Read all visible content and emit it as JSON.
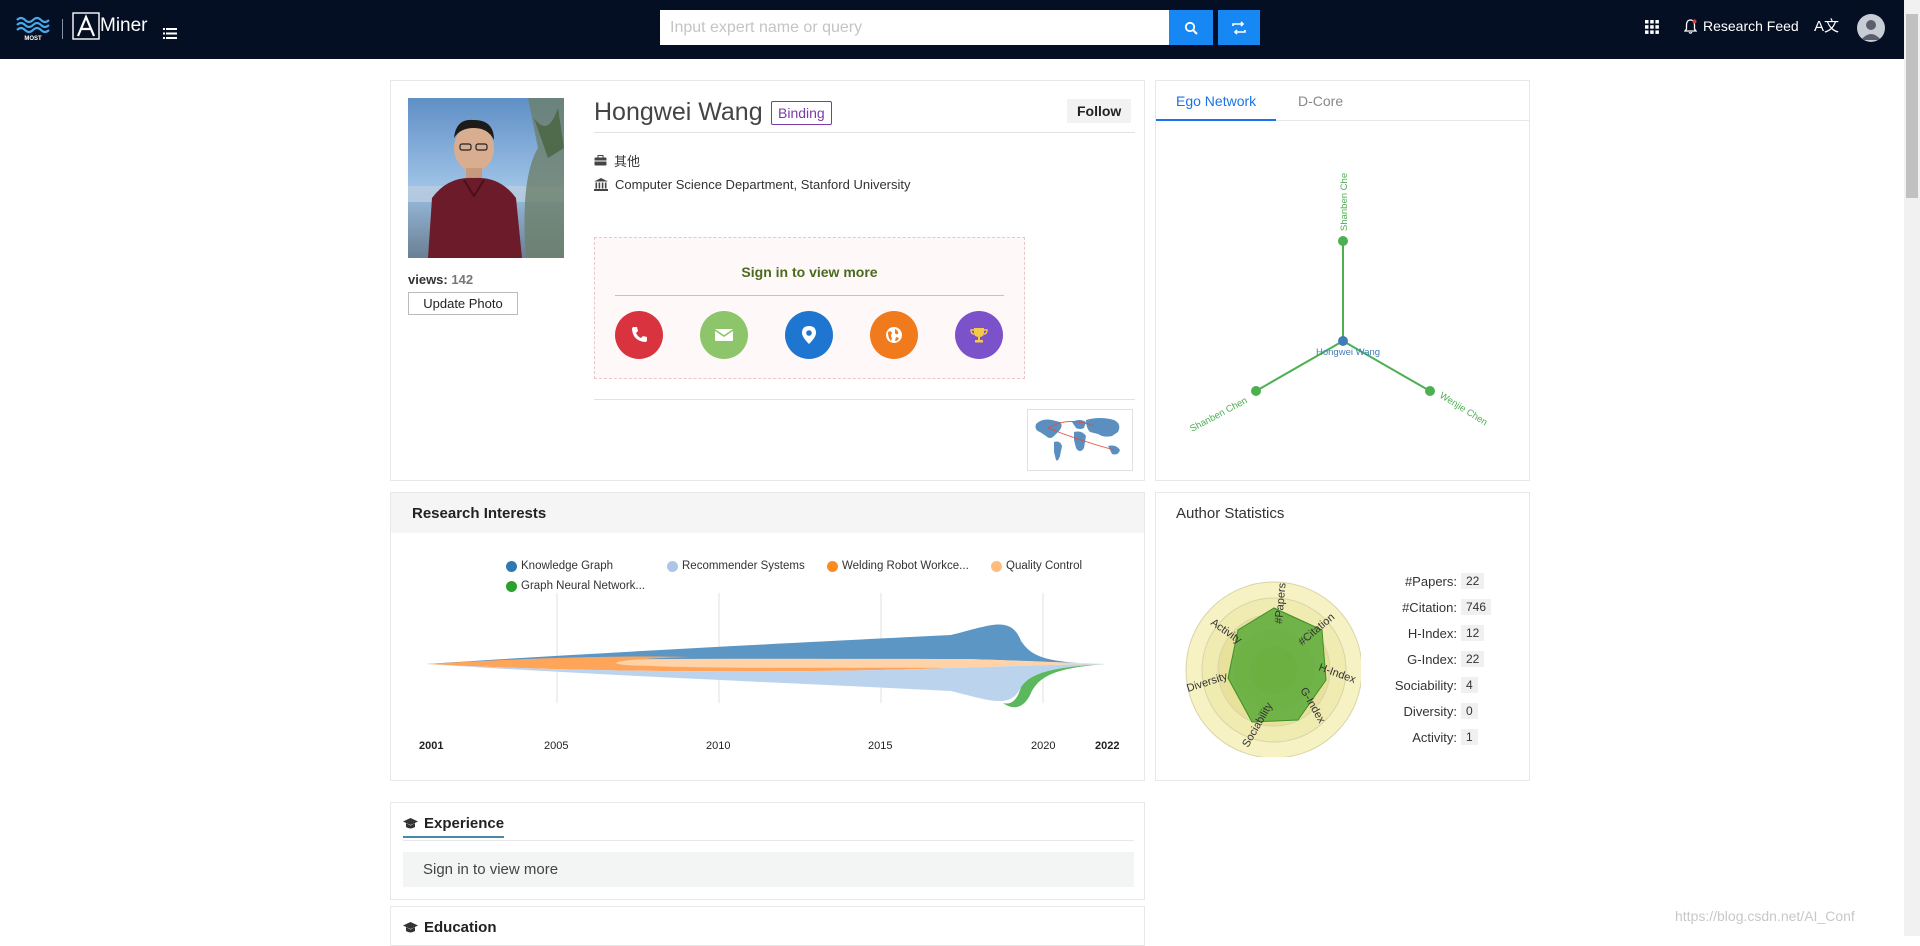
{
  "header": {
    "brand_left": "MOST",
    "brand_right": "Miner",
    "search_placeholder": "Input expert name or query",
    "research_feed": "Research Feed",
    "lang": "A文"
  },
  "profile": {
    "name": "Hongwei Wang",
    "binding": "Binding",
    "follow": "Follow",
    "position": "其他",
    "affiliation": "Computer Science Department, Stanford University",
    "views_label": "views:",
    "views": "142",
    "update_photo": "Update Photo",
    "signin_text": "Sign in to view more",
    "contact_icons": [
      {
        "name": "phone-icon",
        "color": "#d9333f"
      },
      {
        "name": "email-icon",
        "color": "#8cc56a"
      },
      {
        "name": "location-icon",
        "color": "#1f76d0"
      },
      {
        "name": "globe-icon",
        "color": "#f17a1d"
      },
      {
        "name": "trophy-icon",
        "color": "#7b52c9"
      }
    ]
  },
  "ego": {
    "tabs": [
      "Ego Network",
      "D-Core"
    ],
    "center": "Hongwei Wang",
    "nodes": [
      "Shanben Che",
      "Shanben Chen",
      "Wenjie Chen"
    ],
    "color": "#4caf50"
  },
  "interests": {
    "title": "Research Interests",
    "legend": [
      {
        "label": "Knowledge Graph",
        "color": "#2f78b3"
      },
      {
        "label": "Recommender Systems",
        "color": "#adc6e8"
      },
      {
        "label": "Welding Robot Workce...",
        "color": "#ff8a1e"
      },
      {
        "label": "Quality Control",
        "color": "#ffbc7a"
      },
      {
        "label": "Graph Neural Network...",
        "color": "#2ca02c"
      }
    ],
    "axis_ticks": [
      "2001",
      "2005",
      "2010",
      "2015",
      "2020",
      "2022"
    ]
  },
  "stats": {
    "title": "Author Statistics",
    "rows": [
      {
        "label": "#Papers:",
        "value": "22"
      },
      {
        "label": "#Citation:",
        "value": "746"
      },
      {
        "label": "H-Index:",
        "value": "12"
      },
      {
        "label": "G-Index:",
        "value": "22"
      },
      {
        "label": "Sociability:",
        "value": "4"
      },
      {
        "label": "Diversity:",
        "value": "0"
      },
      {
        "label": "Activity:",
        "value": "1"
      }
    ],
    "radar_axes": [
      "#Papers",
      "#Citation",
      "H-Index",
      "G-Index",
      "Sociability",
      "Diversity",
      "Activity"
    ]
  },
  "experience": {
    "title": "Experience",
    "body": "Sign in to view more"
  },
  "education": {
    "title": "Education"
  },
  "watermark": "https://blog.csdn.net/AI_Conf"
}
